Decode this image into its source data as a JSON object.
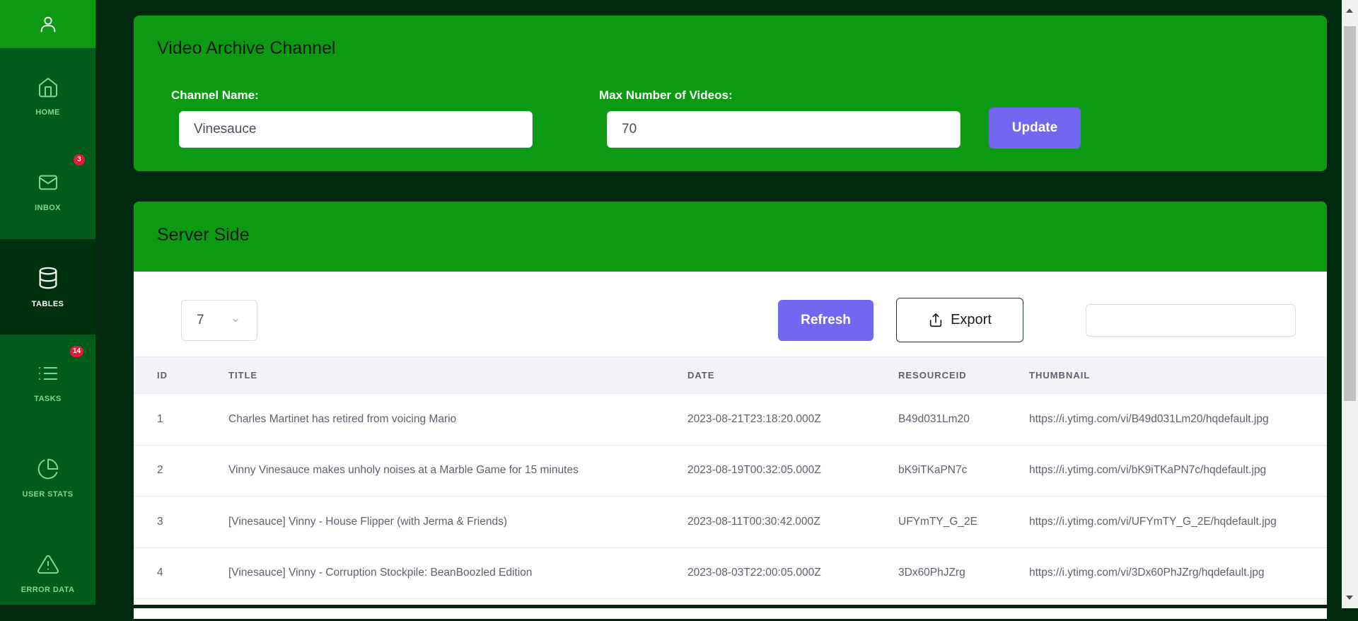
{
  "colors": {
    "sidebar_bg": "#005c1a",
    "sidebar_active": "#00310f",
    "card_green": "#0c9a13",
    "page_bg": "#00290f",
    "accent_purple": "#7367f0",
    "badge_red": "#f0143c"
  },
  "sidebar": {
    "top_icon": "user-icon",
    "items": [
      {
        "label": "HOME",
        "icon": "home-icon"
      },
      {
        "label": "INBOX",
        "icon": "mail-icon",
        "badge": "3"
      },
      {
        "label": "TABLES",
        "icon": "database-icon",
        "active": true
      },
      {
        "label": "TASKS",
        "icon": "list-icon",
        "badge": "14"
      },
      {
        "label": "USER STATS",
        "icon": "pie-chart-icon"
      },
      {
        "label": "ERROR DATA",
        "icon": "alert-triangle-icon"
      }
    ]
  },
  "channel_card": {
    "title": "Video Archive Channel",
    "channel_label": "Channel Name:",
    "channel_value": "Vinesauce",
    "max_label": "Max Number of Videos:",
    "max_value": "70",
    "update_label": "Update"
  },
  "table_card": {
    "title": "Server Side",
    "page_length": "7",
    "refresh_label": "Refresh",
    "export_label": "Export",
    "search_value": "",
    "columns": [
      "ID",
      "TITLE",
      "DATE",
      "RESOURCEID",
      "THUMBNAIL"
    ],
    "rows": [
      [
        "1",
        "Charles Martinet has retired from voicing Mario",
        "2023-08-21T23:18:20.000Z",
        "B49d031Lm20",
        "https://i.ytimg.com/vi/B49d031Lm20/hqdefault.jpg"
      ],
      [
        "2",
        "Vinny Vinesauce makes unholy noises at a Marble Game for 15 minutes",
        "2023-08-19T00:32:05.000Z",
        "bK9iTKaPN7c",
        "https://i.ytimg.com/vi/bK9iTKaPN7c/hqdefault.jpg"
      ],
      [
        "3",
        "[Vinesauce] Vinny - House Flipper (with Jerma & Friends)",
        "2023-08-11T00:30:42.000Z",
        "UFYmTY_G_2E",
        "https://i.ytimg.com/vi/UFYmTY_G_2E/hqdefault.jpg"
      ],
      [
        "4",
        "[Vinesauce] Vinny - Corruption Stockpile: BeanBoozled Edition",
        "2023-08-03T22:00:05.000Z",
        "3Dx60PhJZrg",
        "https://i.ytimg.com/vi/3Dx60PhJZrg/hqdefault.jpg"
      ]
    ]
  }
}
